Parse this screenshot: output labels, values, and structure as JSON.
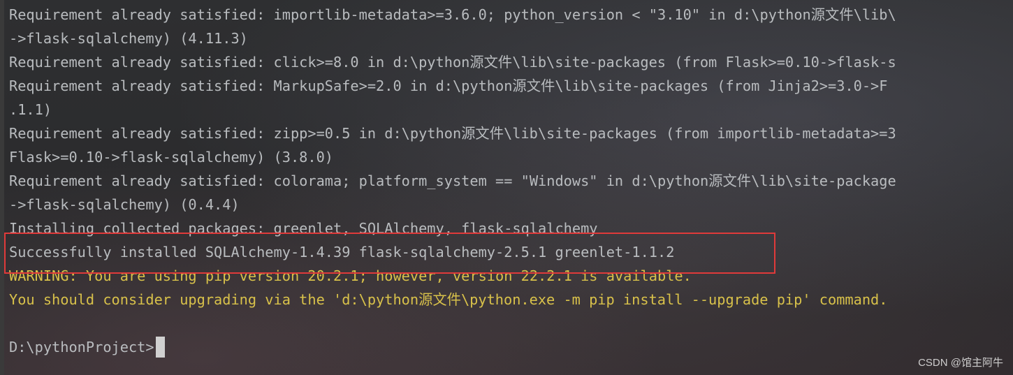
{
  "terminal": {
    "lines": [
      {
        "text": "Requirement already satisfied: importlib-metadata>=3.6.0; python_version < \"3.10\" in d:\\python源文件\\lib\\",
        "kind": "normal"
      },
      {
        "text": "->flask-sqlalchemy) (4.11.3)",
        "kind": "normal"
      },
      {
        "text": "Requirement already satisfied: click>=8.0 in d:\\python源文件\\lib\\site-packages (from Flask>=0.10->flask-s",
        "kind": "normal"
      },
      {
        "text": "Requirement already satisfied: MarkupSafe>=2.0 in d:\\python源文件\\lib\\site-packages (from Jinja2>=3.0->F",
        "kind": "normal"
      },
      {
        "text": ".1.1)",
        "kind": "normal"
      },
      {
        "text": "Requirement already satisfied: zipp>=0.5 in d:\\python源文件\\lib\\site-packages (from importlib-metadata>=3",
        "kind": "normal"
      },
      {
        "text": "Flask>=0.10->flask-sqlalchemy) (3.8.0)",
        "kind": "normal"
      },
      {
        "text": "Requirement already satisfied: colorama; platform_system == \"Windows\" in d:\\python源文件\\lib\\site-package",
        "kind": "normal"
      },
      {
        "text": "->flask-sqlalchemy) (0.4.4)",
        "kind": "normal"
      },
      {
        "text": "Installing collected packages: greenlet, SQLAlchemy, flask-sqlalchemy",
        "kind": "normal"
      },
      {
        "text": "Successfully installed SQLAlchemy-1.4.39 flask-sqlalchemy-2.5.1 greenlet-1.1.2",
        "kind": "normal"
      },
      {
        "text": "WARNING: You are using pip version 20.2.1; however, version 22.2.1 is available.",
        "kind": "warn"
      },
      {
        "text": "You should consider upgrading via the 'd:\\python源文件\\python.exe -m pip install --upgrade pip' command.",
        "kind": "warn"
      },
      {
        "text": "",
        "kind": "normal"
      }
    ],
    "prompt": "D:\\pythonProject>"
  },
  "watermark": "CSDN @馆主阿牛",
  "colors": {
    "background": "#2b2b2b",
    "text": "#b9bcbf",
    "warning": "#d8c14a",
    "highlight_box": "#e03a3a"
  }
}
